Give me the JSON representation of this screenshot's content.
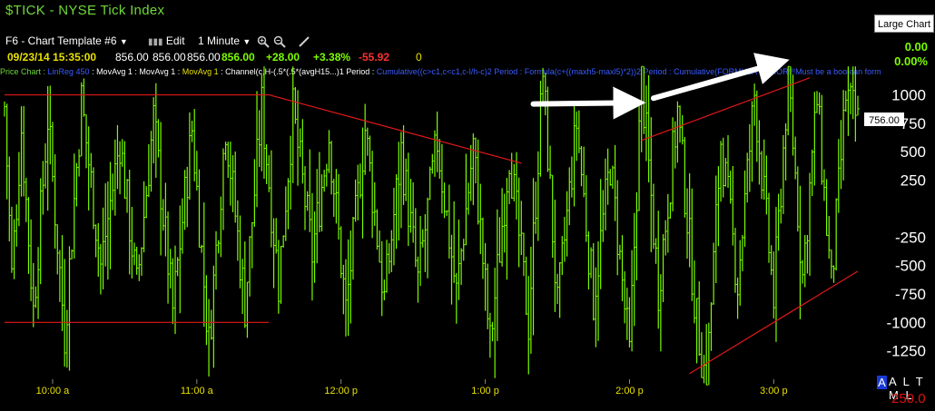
{
  "window": {
    "title": "$TICK - NYSE Tick Index",
    "large_chart_label": "Large Chart"
  },
  "toolbar": {
    "template": "F6 - Chart Template #6",
    "edit_label": "Edit",
    "interval": "1 Minute"
  },
  "quote": {
    "datetime": "09/23/14 15:35:00",
    "open": "856.00",
    "high": "856.00",
    "low": "856.00",
    "last": "856.00",
    "change": "+28.00",
    "pct_change": "+3.38%",
    "other": "-55.92",
    "volume": "0"
  },
  "right_stats": {
    "value1": "0.00",
    "value2": "0.00%"
  },
  "studies": [
    {
      "text": "Price Chart : ",
      "color": "#6fd83a"
    },
    {
      "text": "LinReg 450",
      "color": "#3a5cff"
    },
    {
      "text": " : MovAvg 1 : MovAvg 1 : ",
      "color": "#ffffff"
    },
    {
      "text": "MovAvg 1",
      "color": "#e8e000"
    },
    {
      "text": " : Channel(c,H-(.5*(.5*(avgH15...)1 Period : ",
      "color": "#ffffff"
    },
    {
      "text": "Cumulative((c>c1,c<c1,c-l/h-c)2 Period : Formula(c+((maxh5-maxl5)*2))2 Period : Cumulative(FORMULA ERROR!!!Must be a boolean form",
      "color": "#3a5cff"
    }
  ],
  "bottom": {
    "atml": "A L T M L",
    "scale": "250.0"
  },
  "colors": {
    "price": "#7cfc00",
    "trend": "#e01818",
    "arrow": "#ffffff",
    "time": "#e8e000"
  },
  "chart_data": {
    "type": "bar",
    "title": "$TICK - NYSE Tick Index",
    "interval": "1 Minute",
    "y_ticks": [
      1000,
      750,
      500,
      250,
      -250,
      -500,
      -750,
      -1000,
      -1250
    ],
    "x_ticks": [
      "10:00 a",
      "11:00 a",
      "12:00 p",
      "1:00 p",
      "2:00 p",
      "3:00 p"
    ],
    "ylim": [
      -1500,
      1100
    ],
    "last_value_label": "756.00",
    "series_anchors_time_value": [
      [
        "09:40",
        900
      ],
      [
        "09:43",
        -600
      ],
      [
        "09:47",
        700
      ],
      [
        "09:52",
        -900
      ],
      [
        "09:58",
        800
      ],
      [
        "10:05",
        -1100
      ],
      [
        "10:12",
        950
      ],
      [
        "10:20",
        -500
      ],
      [
        "10:28",
        600
      ],
      [
        "10:35",
        -700
      ],
      [
        "10:42",
        800
      ],
      [
        "10:50",
        -900
      ],
      [
        "10:58",
        700
      ],
      [
        "11:05",
        -1200
      ],
      [
        "11:12",
        750
      ],
      [
        "11:20",
        -850
      ],
      [
        "11:27",
        900
      ],
      [
        "11:34",
        -650
      ],
      [
        "11:40",
        850
      ],
      [
        "11:48",
        -400
      ],
      [
        "11:55",
        650
      ],
      [
        "12:02",
        -900
      ],
      [
        "12:10",
        700
      ],
      [
        "12:18",
        -800
      ],
      [
        "12:25",
        500
      ],
      [
        "12:32",
        -650
      ],
      [
        "12:40",
        600
      ],
      [
        "12:48",
        -750
      ],
      [
        "12:55",
        550
      ],
      [
        "13:02",
        -1200
      ],
      [
        "13:10",
        500
      ],
      [
        "13:18",
        -1000
      ],
      [
        "13:24",
        1200
      ],
      [
        "13:30",
        -900
      ],
      [
        "13:38",
        750
      ],
      [
        "13:45",
        -800
      ],
      [
        "13:52",
        400
      ],
      [
        "14:00",
        -1300
      ],
      [
        "14:05",
        1150
      ],
      [
        "14:12",
        -700
      ],
      [
        "14:20",
        850
      ],
      [
        "14:28",
        -1000
      ],
      [
        "14:32",
        -1550
      ],
      [
        "14:38",
        600
      ],
      [
        "14:45",
        -650
      ],
      [
        "14:52",
        1000
      ],
      [
        "15:00",
        -800
      ],
      [
        "15:06",
        1180
      ],
      [
        "15:12",
        -600
      ],
      [
        "15:18",
        950
      ],
      [
        "15:24",
        -700
      ],
      [
        "15:30",
        1000
      ],
      [
        "15:35",
        756
      ]
    ],
    "annotations": [
      {
        "type": "hline",
        "value": 1000,
        "from": "09:40",
        "to": "11:30"
      },
      {
        "type": "hline",
        "value": -1000,
        "from": "09:40",
        "to": "11:30"
      },
      {
        "type": "trendline",
        "from": [
          "11:30",
          1000
        ],
        "to": [
          "13:15",
          400
        ]
      },
      {
        "type": "trendline",
        "from": [
          "14:05",
          600
        ],
        "to": [
          "15:15",
          1150
        ]
      },
      {
        "type": "trendline",
        "from": [
          "14:25",
          -1450
        ],
        "to": [
          "15:35",
          -550
        ]
      },
      {
        "type": "arrow",
        "from": [
          "13:20",
          920
        ],
        "to": [
          "14:00",
          930
        ]
      },
      {
        "type": "arrow",
        "from": [
          "14:10",
          970
        ],
        "to": [
          "15:00",
          1270
        ]
      }
    ]
  }
}
